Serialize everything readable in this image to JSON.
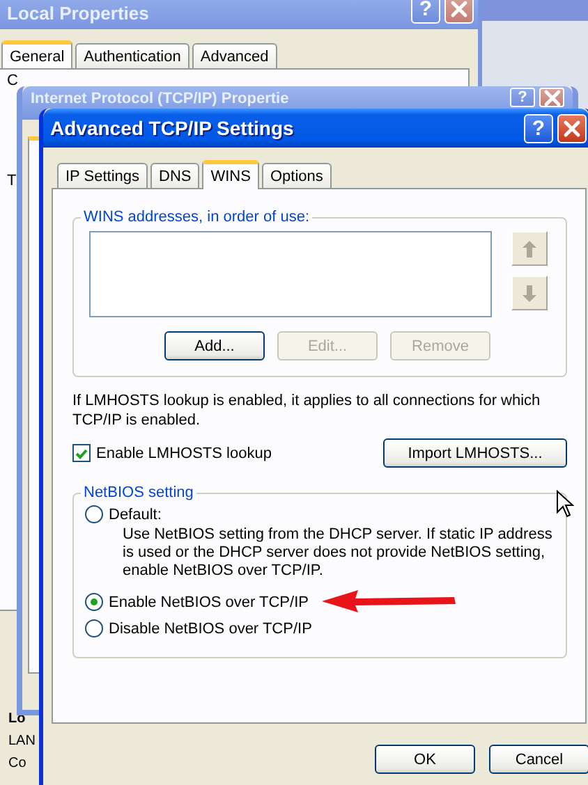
{
  "background_windows": [
    {
      "title": "Local Properties",
      "help_label": "?",
      "tabs": [
        {
          "label": "General",
          "selected": true
        },
        {
          "label": "Authentication",
          "selected": false
        },
        {
          "label": "Advanced",
          "selected": false
        }
      ],
      "panel_texts": [
        "C",
        "T"
      ],
      "footer_texts": [
        "Lo",
        "LAN",
        "Co"
      ]
    },
    {
      "title": "Internet Protocol (TCP/IP) Propertie",
      "help_label": "?"
    }
  ],
  "dialog": {
    "title": "Advanced TCP/IP Settings",
    "help_label": "?",
    "tabs": [
      {
        "label": "IP Settings",
        "selected": false
      },
      {
        "label": "DNS",
        "selected": false
      },
      {
        "label": "WINS",
        "selected": true
      },
      {
        "label": "Options",
        "selected": false
      }
    ],
    "wins_group": {
      "label": "WINS addresses, in order of use:",
      "move_buttons": [
        {
          "kind": "up",
          "disabled": true
        },
        {
          "kind": "down",
          "disabled": true
        }
      ],
      "buttons": [
        {
          "label": "Add...",
          "disabled": false
        },
        {
          "label": "Edit...",
          "disabled": true
        },
        {
          "label": "Remove",
          "disabled": true
        }
      ]
    },
    "lmhosts_note": "If LMHOSTS lookup is enabled, it applies to all connections for which TCP/IP is enabled.",
    "lmhosts_checkbox": {
      "label": "Enable LMHOSTS lookup",
      "checked": true
    },
    "import_button": "Import LMHOSTS...",
    "netbios": {
      "label": "NetBIOS setting",
      "options": [
        {
          "label": "Default:",
          "description": "Use NetBIOS setting from the DHCP server. If static IP address is used or the DHCP server does not provide NetBIOS setting, enable NetBIOS over TCP/IP.",
          "selected": false
        },
        {
          "label": "Enable NetBIOS over TCP/IP",
          "selected": true
        },
        {
          "label": "Disable NetBIOS over TCP/IP",
          "selected": false
        }
      ]
    },
    "buttons": [
      {
        "label": "OK"
      },
      {
        "label": "Cancel"
      }
    ]
  }
}
